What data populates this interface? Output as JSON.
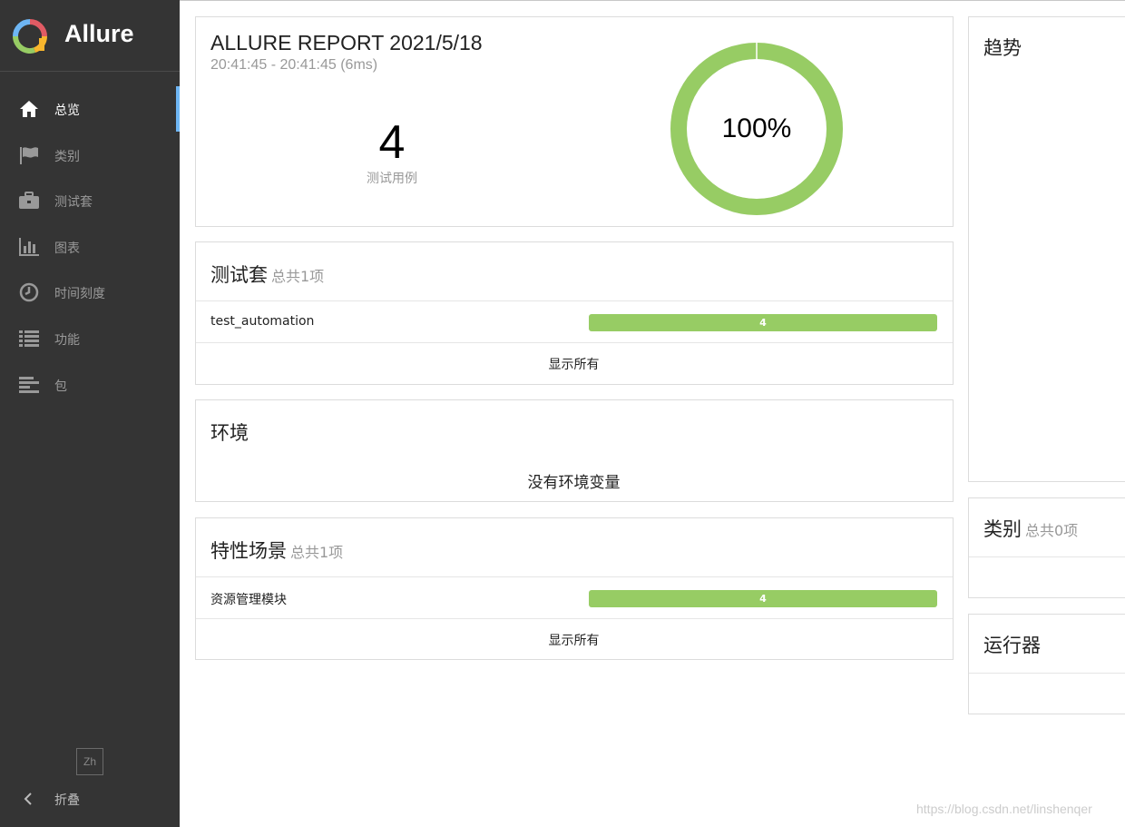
{
  "brand": {
    "name": "Allure"
  },
  "sidebar": {
    "items": [
      {
        "label": "总览",
        "icon": "home-icon",
        "active": true
      },
      {
        "label": "类别",
        "icon": "flag-icon",
        "active": false
      },
      {
        "label": "测试套",
        "icon": "briefcase-icon",
        "active": false
      },
      {
        "label": "图表",
        "icon": "bar-chart-icon",
        "active": false
      },
      {
        "label": "时间刻度",
        "icon": "clock-icon",
        "active": false
      },
      {
        "label": "功能",
        "icon": "list-icon",
        "active": false
      },
      {
        "label": "包",
        "icon": "align-left-icon",
        "active": false
      }
    ],
    "language": "Zh",
    "collapse_label": "折叠"
  },
  "summary": {
    "title": "ALLURE REPORT 2021/5/18",
    "time": "20:41:45 - 20:41:45 (6ms)",
    "test_count": "4",
    "test_count_label": "测试用例",
    "pass_rate": "100%",
    "pass_fraction": 1.0
  },
  "suites": {
    "title": "测试套",
    "count_label": "总共1项",
    "rows": [
      {
        "name": "test_automation",
        "passed": "4"
      }
    ],
    "show_all": "显示所有"
  },
  "environment": {
    "title": "环境",
    "empty_text": "没有环境变量"
  },
  "features": {
    "title": "特性场景",
    "count_label": "总共1项",
    "rows": [
      {
        "name": "资源管理模块",
        "passed": "4"
      }
    ],
    "show_all": "显示所有"
  },
  "trend": {
    "title": "趋势"
  },
  "categories": {
    "title": "类别",
    "count_label": "总共0项"
  },
  "executors": {
    "title": "运行器"
  },
  "watermark": "https://blog.csdn.net/linshenqer",
  "colors": {
    "sidebar_bg": "#343434",
    "passed": "#97cc64",
    "active_indicator": "#6eb6f4"
  }
}
